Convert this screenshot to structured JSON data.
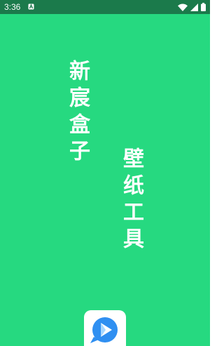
{
  "status_bar": {
    "time": "3:36",
    "notification_icon": "a-badge-icon",
    "icons": [
      "wifi-icon",
      "cellular-signal-icon",
      "battery-icon"
    ]
  },
  "splash": {
    "title_line1": "新宸盒子",
    "title_line2": "壁纸工具",
    "logo_icon": "play-chat-bubble-icon"
  },
  "colors": {
    "background": "#26d980",
    "status_bar": "#1b7a4b",
    "text": "#ffffff",
    "logo_blue": "#2f8ff1",
    "logo_light_blue": "#a8d8ff"
  }
}
